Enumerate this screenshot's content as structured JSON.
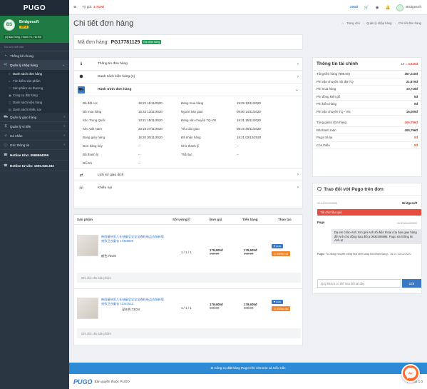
{
  "sidebar": {
    "brand": "PUGO",
    "user": {
      "name": "Bridgesoft",
      "badge": "VIP 0",
      "address": "[1] Bạc Đông, Thanh Trì, Hà Nội",
      "avatar": "BS"
    },
    "search_placeholder": "Tra cứu mã vận",
    "items": [
      {
        "label": "Thống kê chung",
        "icon": "dashboard-icon",
        "glyph": "▪"
      },
      {
        "label": "Quản lý nhập hàng",
        "icon": "cart-icon",
        "glyph": "🛒",
        "chevron": "⌄"
      }
    ],
    "subitems": [
      {
        "label": "Danh sách đơn hàng",
        "glyph": "≡"
      },
      {
        "label": "Tìm kiếm sản phẩm",
        "glyph": "⌕"
      },
      {
        "label": "Sản phẩm ưa thương",
        "glyph": "♡"
      },
      {
        "label": "Công cụ đặt hàng",
        "glyph": "▣"
      },
      {
        "label": "Danh sách kiện hàng",
        "glyph": "▢"
      },
      {
        "label": "Danh sách khiếu nại",
        "glyph": "▤"
      }
    ],
    "items2": [
      {
        "label": "Quản lý giao hàng",
        "glyph": "⛟",
        "chevron": "›"
      },
      {
        "label": "Quản lý ví tiền",
        "glyph": "$",
        "chevron": "›"
      },
      {
        "label": "Cá nhân",
        "glyph": "☺",
        "chevron": "›"
      },
      {
        "label": "Góc thông tin",
        "glyph": "ⓘ",
        "chevron": "›"
      }
    ],
    "hotlines": [
      {
        "label": "Hotline Kho: 0969964096",
        "glyph": "☎"
      },
      {
        "label": "Hotline tư vấn: 1900.633.492",
        "glyph": "☎"
      }
    ]
  },
  "header": {
    "menu_glyph": "≡",
    "rate_label": "Tỷ giá:",
    "rate_value": "3.710đ",
    "balance": "204đ",
    "cart_glyph": "🛒",
    "globe_glyph": "◉",
    "bell_glyph": "🔔",
    "username": "Bridgesoft"
  },
  "page": {
    "title": "Chi tiết đơn hàng",
    "breadcrumb": {
      "home": "Trang chủ",
      "sep": "›",
      "section": "Quản lý nhập hàng",
      "current": "Chi tiết đơn hàng",
      "home_glyph": "⌂"
    }
  },
  "order": {
    "code_label": "Mã đơn hàng:",
    "code": "PG17781129",
    "status": "Đã nhận hàng"
  },
  "accordion": [
    {
      "label": "Thông tin đơn hàng",
      "glyph": "ℹ",
      "chevron": "›"
    },
    {
      "label": "Danh sách kiện hàng (1)",
      "glyph": "⬢",
      "chevron": "›"
    },
    {
      "label": "Hành trình đơn hàng",
      "glyph": "⛟",
      "chevron": "⌄"
    }
  ],
  "journey": [
    [
      "Đã đặt cọc",
      "19:22 11/11/2020",
      "Đang mua hàng",
      "15:29 13/11/2020"
    ],
    [
      "Đã mua hàng",
      "15:33 13/11/2020",
      "Người bán giao",
      "09:00 14/11/2020"
    ],
    [
      "Kho Trung Quốc",
      "13:21 15/11/2020",
      "Đang vận chuyển TQ-VN",
      "16:31 15/11/2020"
    ],
    [
      "Kho Việt Nam",
      "20:18 27/11/2020",
      "Yêu cầu giao",
      "08:16 30/11/2020"
    ],
    [
      "Đang giao hàng",
      "16:20 30/11/2020",
      "Đã nhận hàng",
      "16:21 03/12/2020"
    ],
    [
      "Đơn hàng hủy",
      "--",
      "Chờ thanh lý",
      "--"
    ],
    [
      "Đã thanh lý",
      "--",
      "Thất lạc",
      "--"
    ],
    [
      "Đổi trả",
      "--",
      "",
      ""
    ]
  ],
  "accordion2": [
    {
      "label": "Lịch sử giao dịch",
      "glyph": "⇄",
      "chevron": "›"
    },
    {
      "label": "Khiếu nại",
      "glyph": "☏",
      "chevron": "›"
    }
  ],
  "products": {
    "headers": {
      "product": "Sản phẩm",
      "qty": "Số lượng",
      "qty_icon": "ⓘ",
      "price": "Đơn giá",
      "amount": "Tiền hàng",
      "action": "Thao tác"
    },
    "items": [
      {
        "name": "韩国童装男儿长袖童宝宝宝宝春秋新品衣服新版夜款卫衣童衣 17388595",
        "attr": "颜色:73CM",
        "qty": "1 / 1 / 1",
        "price": "178,605đ",
        "price_cny": "¥49.00",
        "amount": "178,605đ",
        "amount_cny": "¥49.00",
        "love": "♥ Lưu",
        "complain": "⚠ Khiếu nại",
        "note": "Ghi chú cho sản phẩm"
      },
      {
        "name": "韩国童装男儿长袖童宝宝宝宝春秋新品衣服新版夜款卫衣童衣 72167522",
        "attr": "深灰色:73CM",
        "qty": "1 / 1 / 1",
        "price": "178,605đ",
        "price_cny": "¥49.00",
        "amount": "178,605đ",
        "amount_cny": "¥49.00",
        "love": "♥ Lưu",
        "complain": "⚠ Khiếu nại",
        "note": "Ghi chú cho sản phẩm"
      }
    ]
  },
  "finance": {
    "title": "Thông tin tài chính",
    "rate_label": "1¥ =",
    "rate_value": "3,645đ",
    "rows_a": [
      {
        "label": "Tổng tiền hàng (¥98.00)",
        "value": "357,210đ",
        "cls": ""
      },
      {
        "label": "Phí vận chuyển nội địa TQ",
        "value": "21,870đ",
        "cls": ""
      },
      {
        "label": "Phí mua hàng",
        "value": "10,716đ",
        "cls": ""
      },
      {
        "label": "Phí đóng kiện gỗ",
        "value": "0đ",
        "cls": ""
      },
      {
        "label": "Phí kiểm hàng",
        "value": "0đ",
        "cls": ""
      },
      {
        "label": "Phí vận chuyển TQ - VN",
        "value": "16,000đ",
        "cls": ""
      }
    ],
    "rows_b": [
      {
        "label": "Tổng giá trị đơn hàng",
        "value": "405,796đ",
        "cls": "red"
      },
      {
        "label": "Đã thanh toán",
        "value": "405,796đ",
        "cls": ""
      },
      {
        "label": "Pugo trả lại",
        "value": "0đ",
        "cls": "orange"
      },
      {
        "label": "Còn thiếu",
        "value": "0đ",
        "cls": "orange"
      }
    ]
  },
  "chat": {
    "title": "Trao đổi với Pugo trên đơn",
    "title_glyph": "🗨",
    "msg1_time": "12:44 01/12/2020",
    "msg1_user": "Bridgesoft",
    "msg1_text": "Tôi chờ lâu quá",
    "msg2_user": "Pugo",
    "msg2_time": "10:33 01/12/2020",
    "msg2_text": "Dạ em chào Anh. Em gửi Anh số điện thoại của bạn giao hàng để Anh chủ động trao đổi ạ 0832306898. Pugo xin thông tin Anh ạ!",
    "sys_user": "Pugo:",
    "sys_text": "Tự động chuyển trạng thái đơn sang Đã Nhận hàng",
    "sys_time": "- 16:21 03/12/2020",
    "input_placeholder": "Quý khách có thể trao đổi tại đây",
    "send": "Gửi"
  },
  "bottom": {
    "banner": "⊕ Công cụ đặt hàng Pugo trên Chrome và Cốc Cốc",
    "logo": "PUGO",
    "copyright": "Bản quyền thuộc PUGO",
    "version": "Version 1.0"
  }
}
